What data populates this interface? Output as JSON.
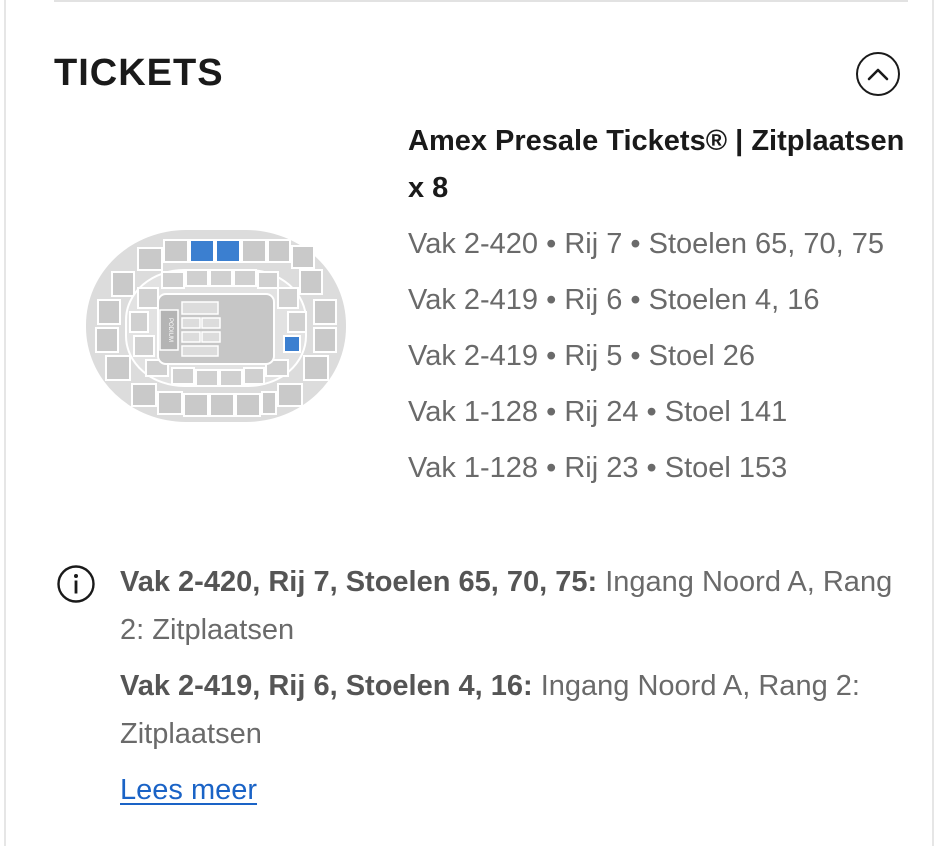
{
  "section": {
    "title": "TICKETS"
  },
  "ticket": {
    "name": "Amex Presale Tickets® | Zitplaatsen x 8",
    "seats": [
      "Vak 2-420 • Rij 7 • Stoelen 65, 70, 75",
      "Vak 2-419 • Rij 6 • Stoelen 4, 16",
      "Vak 2-419 • Rij 5 • Stoel 26",
      "Vak 1-128 • Rij 24 • Stoel 141",
      "Vak 1-128 • Rij 23 • Stoel 153"
    ]
  },
  "entrance": {
    "items": [
      {
        "seats": "Vak 2-420, Rij 7, Stoelen 65, 70, 75:",
        "text": " Ingang Noord A, Rang 2: Zitplaatsen"
      },
      {
        "seats": "Vak 2-419, Rij 6, Stoelen 4, 16:",
        "text": " Ingang Noord A, Rang 2: Zitplaatsen"
      }
    ],
    "read_more": "Lees meer"
  },
  "seatmap": {
    "stage_label": "PODIUM"
  },
  "colors": {
    "selected_section": "#3b7fd0",
    "venue_fill": "#dcdcdc",
    "link": "#1a63c6"
  },
  "icons": {
    "collapse": "chevron-up-icon",
    "info": "info-icon"
  }
}
